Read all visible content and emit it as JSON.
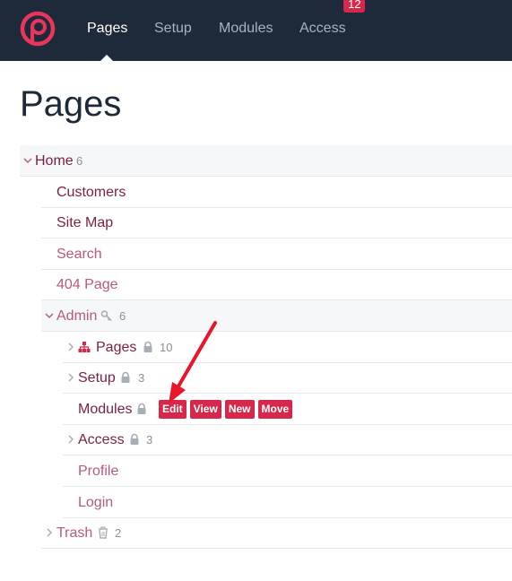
{
  "nav": {
    "items": [
      "Pages",
      "Setup",
      "Modules",
      "Access"
    ],
    "access_badge": "12"
  },
  "page": {
    "title": "Pages"
  },
  "tree": {
    "home": {
      "label": "Home",
      "count": "6"
    },
    "customers": {
      "label": "Customers"
    },
    "site_map": {
      "label": "Site Map"
    },
    "search": {
      "label": "Search"
    },
    "not_found": {
      "label": "404 Page"
    },
    "admin": {
      "label": "Admin",
      "count": "6"
    },
    "pages": {
      "label": "Pages",
      "count": "10"
    },
    "setup": {
      "label": "Setup",
      "count": "3"
    },
    "modules": {
      "label": "Modules",
      "actions": [
        "Edit",
        "View",
        "New",
        "Move"
      ]
    },
    "access": {
      "label": "Access",
      "count": "3"
    },
    "profile": {
      "label": "Profile"
    },
    "login": {
      "label": "Login"
    },
    "trash": {
      "label": "Trash",
      "count": "2"
    }
  },
  "colors": {
    "topbar": "#1e2a3a",
    "accent": "#d5284a",
    "link_dark": "#7d1f3f",
    "link_light": "#b85a78",
    "annotation_arrow": "#e8152b"
  },
  "icons": {
    "logo": "processwire-logo",
    "key": "key-icon",
    "lock": "lock-icon",
    "sitemap": "sitemap-icon",
    "trash": "trash-icon"
  }
}
